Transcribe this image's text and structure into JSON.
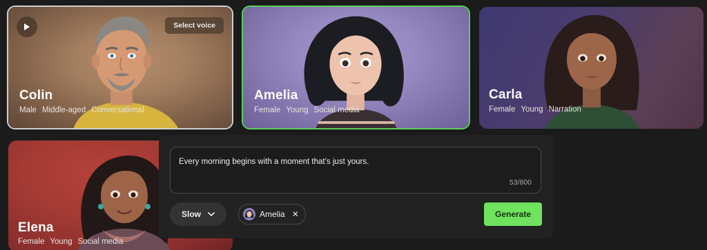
{
  "colors": {
    "page_background": "#1b1b1b",
    "selected_card_border": "#58d15a",
    "hover_card_border": "#cfcfcf",
    "generate_button": "#6fe25e",
    "composer_background": "#222222"
  },
  "voices": [
    {
      "name": "Colin",
      "tags": [
        "Male",
        "Middle-aged",
        "Conversational"
      ],
      "state": "hovered",
      "play_icon": "play-icon",
      "select_label": "Select voice"
    },
    {
      "name": "Amelia",
      "tags": [
        "Female",
        "Young",
        "Social media"
      ],
      "state": "selected"
    },
    {
      "name": "Carla",
      "tags": [
        "Female",
        "Young",
        "Narration"
      ],
      "state": "default"
    },
    {
      "name": "Elena",
      "tags": [
        "Female",
        "Young",
        "Social media"
      ],
      "state": "default"
    }
  ],
  "composer": {
    "text_value": "Every morning begins with a moment that’s just yours.",
    "char_count": "53/800",
    "speed": {
      "selected": "Slow",
      "icon": "chevron-down-icon"
    },
    "voice_chip": {
      "label": "Amelia",
      "remove_icon": "close-icon"
    },
    "generate_label": "Generate"
  }
}
